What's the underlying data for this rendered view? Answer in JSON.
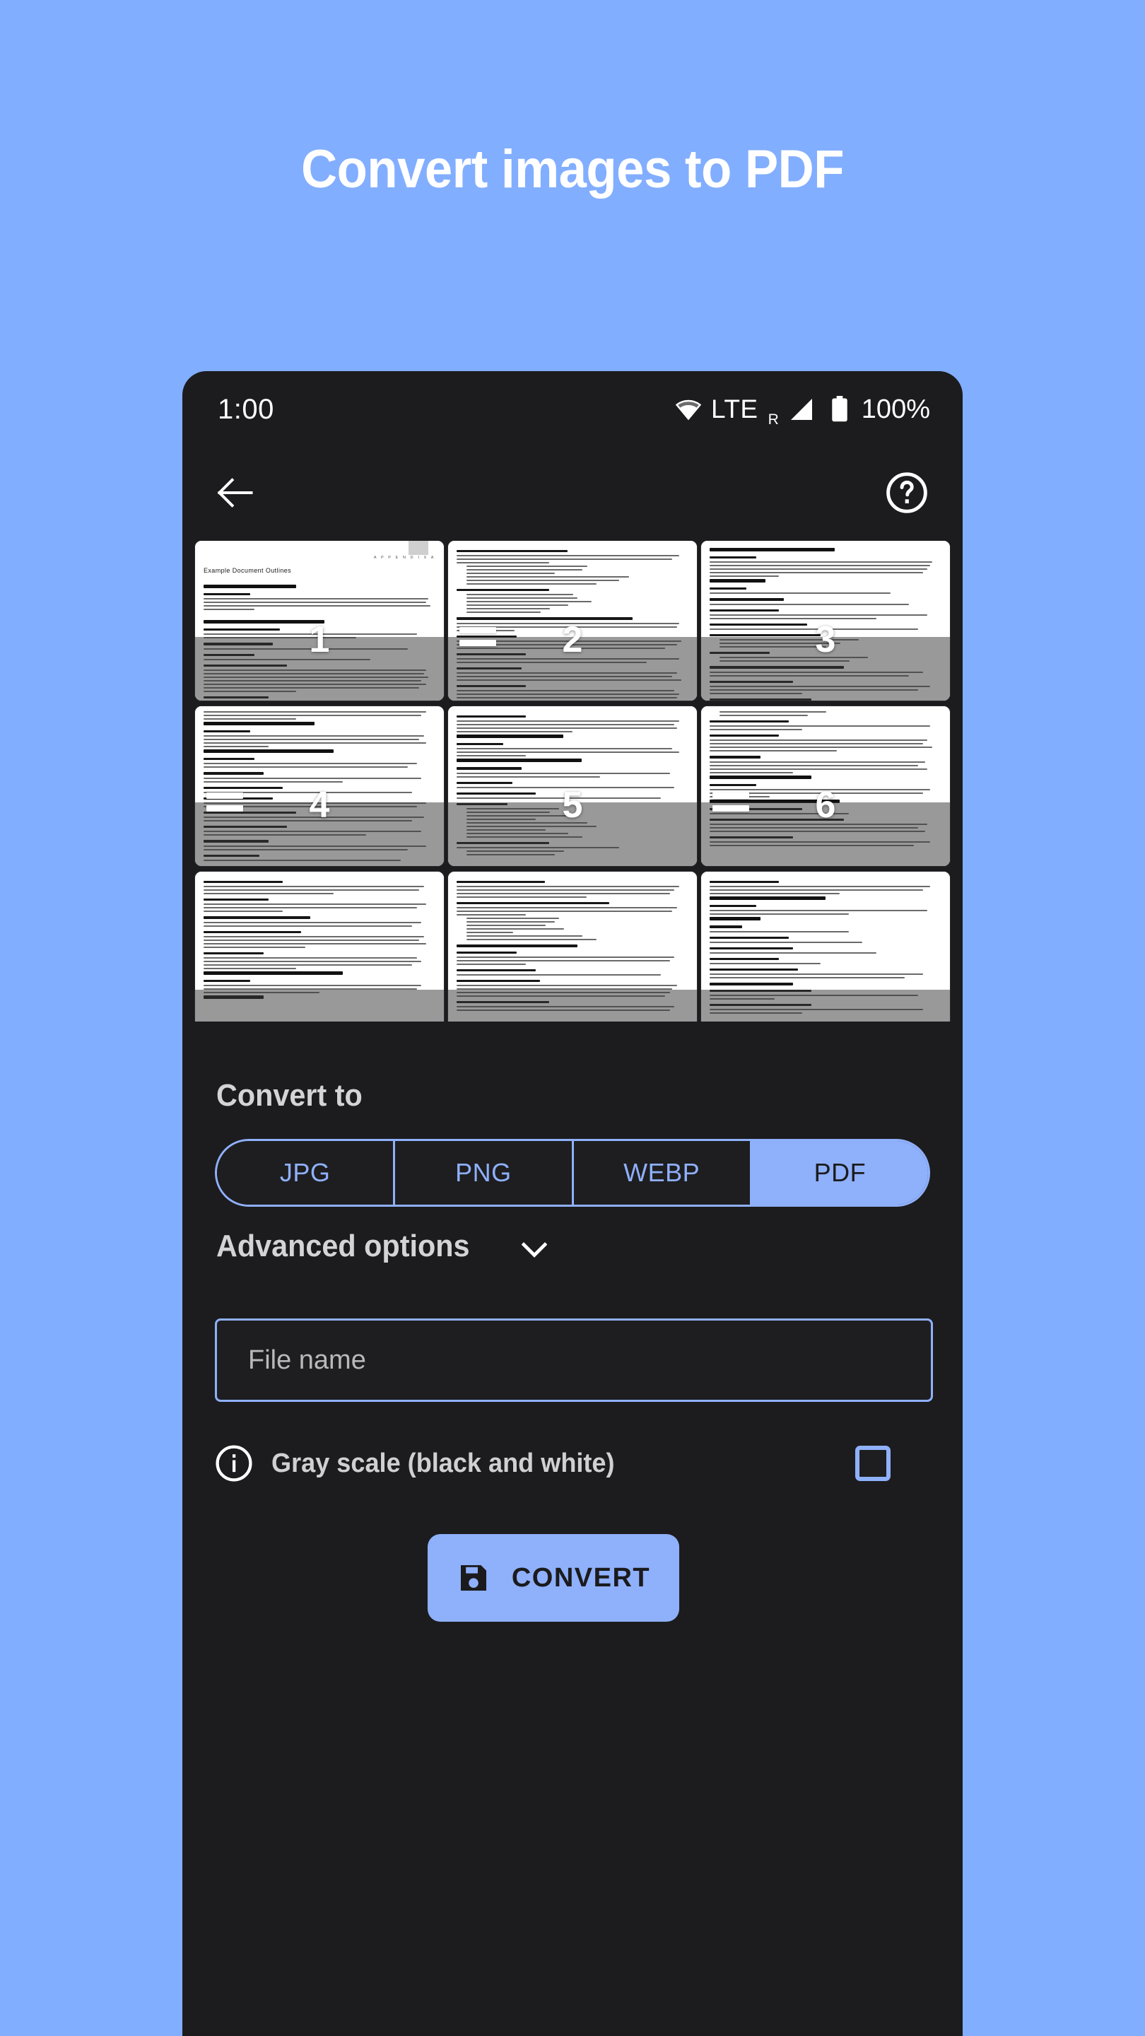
{
  "hero": {
    "title": "Convert images to PDF"
  },
  "statusbar": {
    "time": "1:00",
    "network_label": "LTE",
    "roaming_indicator": "R",
    "battery_percent": "100%",
    "icons": [
      "wifi-icon",
      "signal-icon",
      "battery-icon"
    ]
  },
  "appbar": {
    "back_icon": "back-arrow-icon",
    "help_icon": "help-circle-icon"
  },
  "thumbnails": [
    {
      "number": "1",
      "appendix": "A P P E N D I X   A",
      "title": "Example Document Outlines",
      "has_drag_handle": false,
      "section1": "IT Master Plan",
      "section2": "Purpose",
      "section3": "Outline and Contents"
    },
    {
      "number": "2",
      "has_drag_handle": true,
      "section1": "4.2 Network Architecture",
      "section2": "4.3 Application Systems",
      "section3": "4.4 Interoperability and IT Management Systems"
    },
    {
      "number": "3",
      "has_drag_handle": false,
      "section1": "Concept of Operations",
      "section2": "Purpose",
      "section3": "Outline"
    },
    {
      "number": "4",
      "has_drag_handle": true,
      "section1": "System Definition",
      "section2": "Purpose",
      "section3": "Outline and Contents"
    },
    {
      "number": "5",
      "has_drag_handle": false,
      "section1": "Value Proposition",
      "section2": "Purpose",
      "section3": "Outline and Contents"
    },
    {
      "number": "6",
      "has_drag_handle": true,
      "section1": "Project Charter",
      "section2": "Purpose",
      "section3": "Outline and Contents"
    },
    {
      "number": "",
      "has_drag_handle": false,
      "section1": "Project Management Plan",
      "section2": "Purpose",
      "section3": "Outline"
    },
    {
      "number": "",
      "has_drag_handle": false,
      "section1": "4.3 Assumptions and Risks",
      "section2": "5. Organizational Responsibility and Authority",
      "section3": "6. Work Breakdown Structure (WBS)"
    },
    {
      "number": "",
      "has_drag_handle": false,
      "section1": "System Specification",
      "section2": "Purpose",
      "section3": "Outline"
    }
  ],
  "convert_to": {
    "heading": "Convert to",
    "formats": [
      {
        "label": "JPG",
        "selected": false
      },
      {
        "label": "PNG",
        "selected": false
      },
      {
        "label": "WEBP",
        "selected": false
      },
      {
        "label": "PDF",
        "selected": true
      }
    ]
  },
  "advanced": {
    "heading": "Advanced options",
    "chevron_icon": "chevron-down-icon",
    "expanded": false
  },
  "filename": {
    "value": "",
    "placeholder": "File name"
  },
  "grayscale": {
    "info_icon": "info-icon",
    "label": "Gray scale (black and white)",
    "checked": false
  },
  "convert_button": {
    "label": "CONVERT",
    "icon": "save-icon"
  },
  "colors": {
    "background": "#82aeff",
    "accent": "#8fb0fb",
    "phone_surface": "#1c1c1e",
    "text_primary": "#d4d4d6"
  }
}
